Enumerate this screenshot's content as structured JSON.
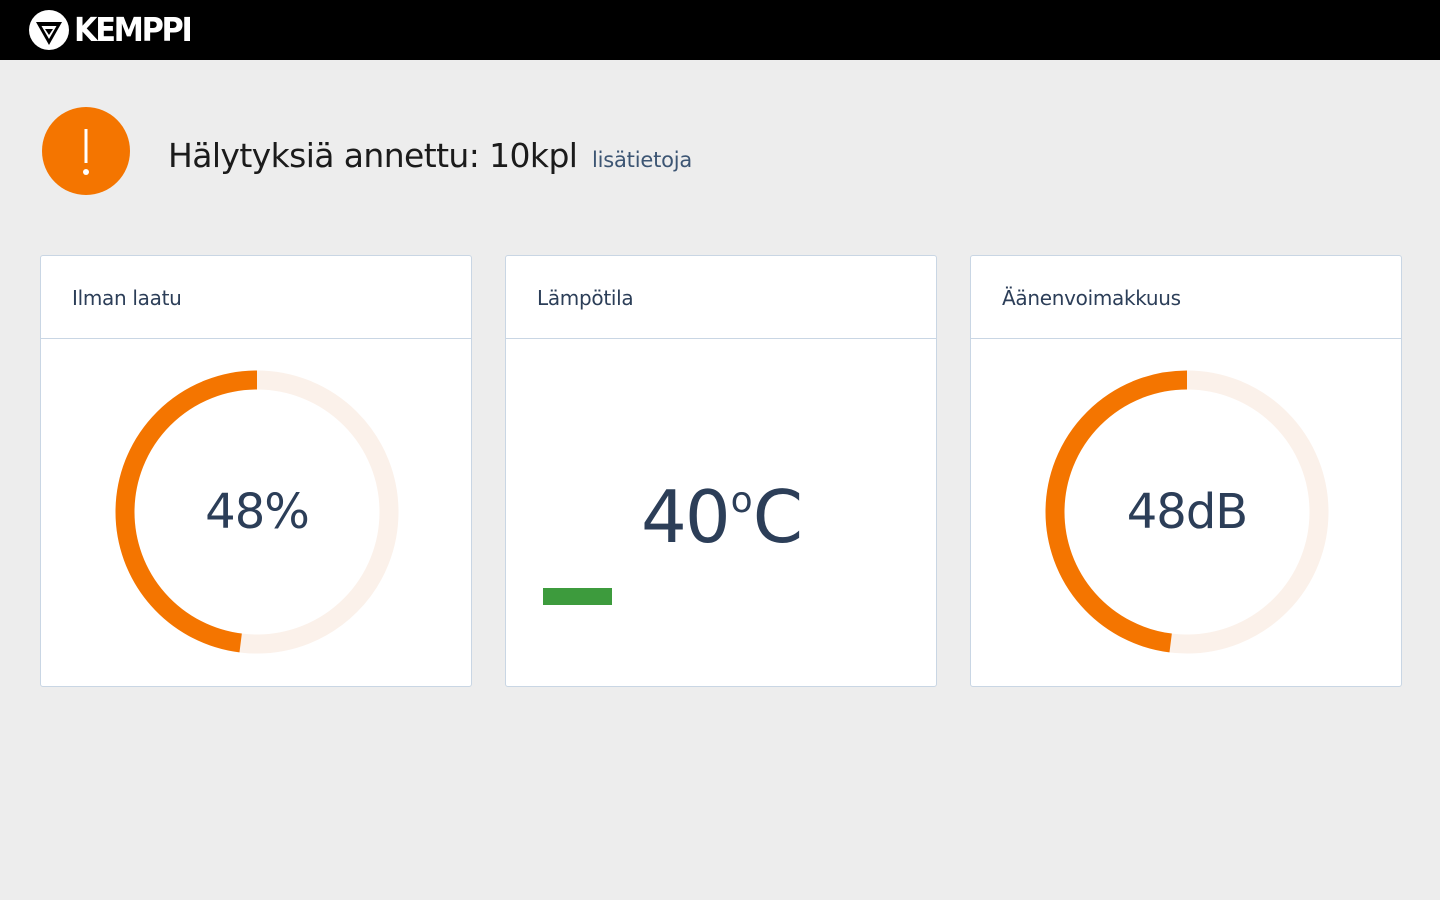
{
  "header": {
    "logo_text": "KEMPPI",
    "logo_icon": "kemppi-shield-icon"
  },
  "alert": {
    "icon": "exclamation-icon",
    "color": "#f47500",
    "text": "Hälytyksiä annettu: 10kpl",
    "link": "lisätietoja"
  },
  "cards": [
    {
      "title": "Ilman laatu",
      "value": "48%",
      "gauge_fraction": 0.48,
      "color": "#f47500"
    },
    {
      "title": "Lämpötila",
      "value_number": "40",
      "value_degree": "o",
      "value_unit": "C",
      "indicator_color": "#3d9b3d"
    },
    {
      "title": "Äänenvoimakkuus",
      "value": "48dB",
      "gauge_fraction": 0.48,
      "color": "#f47500"
    }
  ],
  "colors": {
    "accent": "#f47500",
    "track": "#fbf1ea",
    "text": "#2c3e58",
    "ok": "#3d9b3d"
  }
}
